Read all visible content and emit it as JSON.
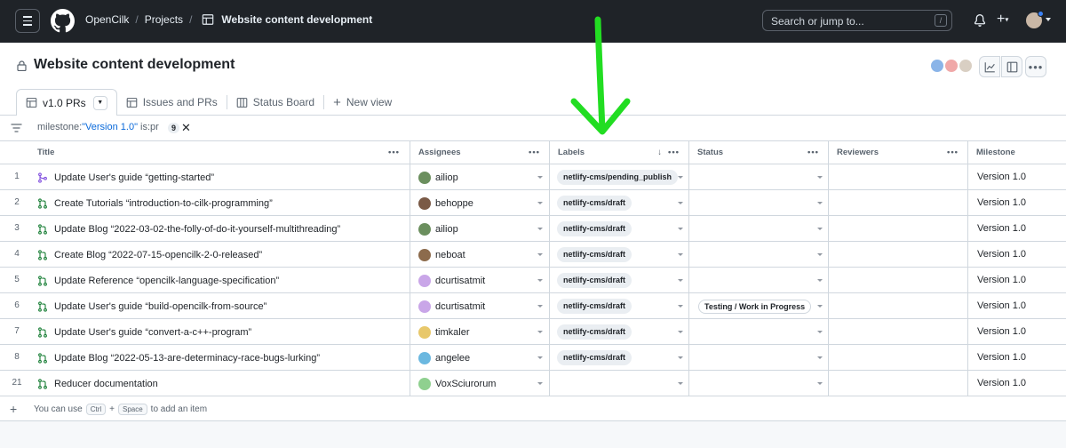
{
  "header": {
    "org": "OpenCilk",
    "projects": "Projects",
    "project_name": "Website content development",
    "search_placeholder": "Search or jump to...",
    "search_key": "/"
  },
  "project": {
    "title": "Website content development"
  },
  "tabs": [
    {
      "label": "v1.0 PRs",
      "active": true
    },
    {
      "label": "Issues and PRs",
      "active": false
    },
    {
      "label": "Status Board",
      "active": false
    },
    {
      "label": "New view",
      "active": false
    }
  ],
  "filter": {
    "prefix": "milestone:",
    "value": "\"Version 1.0\"",
    "suffix": " is:pr",
    "count": "9"
  },
  "columns": {
    "title": "Title",
    "assignees": "Assignees",
    "labels": "Labels",
    "status": "Status",
    "reviewers": "Reviewers",
    "milestone": "Milestone"
  },
  "rows": [
    {
      "num": "1",
      "title": "Update User's guide “getting-started”",
      "assignee": "ailiop",
      "label": "netlify-cms/pending_publish",
      "status": "",
      "milestone": "Version 1.0",
      "icon": "merged"
    },
    {
      "num": "2",
      "title": "Create Tutorials “introduction-to-cilk-programming”",
      "assignee": "behoppe",
      "label": "netlify-cms/draft",
      "status": "",
      "milestone": "Version 1.0",
      "icon": "open"
    },
    {
      "num": "3",
      "title": "Update Blog “2022-03-02-the-folly-of-do-it-yourself-multithreading”",
      "assignee": "ailiop",
      "label": "netlify-cms/draft",
      "status": "",
      "milestone": "Version 1.0",
      "icon": "open"
    },
    {
      "num": "4",
      "title": "Create Blog “2022-07-15-opencilk-2-0-released”",
      "assignee": "neboat",
      "label": "netlify-cms/draft",
      "status": "",
      "milestone": "Version 1.0",
      "icon": "open"
    },
    {
      "num": "5",
      "title": "Update Reference “opencilk-language-specification”",
      "assignee": "dcurtisatmit",
      "label": "netlify-cms/draft",
      "status": "",
      "milestone": "Version 1.0",
      "icon": "open"
    },
    {
      "num": "6",
      "title": "Update User's guide “build-opencilk-from-source”",
      "assignee": "dcurtisatmit",
      "label": "netlify-cms/draft",
      "status": "Testing / Work in Progress",
      "milestone": "Version 1.0",
      "icon": "open"
    },
    {
      "num": "7",
      "title": "Update User's guide “convert-a-c++-program”",
      "assignee": "timkaler",
      "label": "netlify-cms/draft",
      "status": "",
      "milestone": "Version 1.0",
      "icon": "open"
    },
    {
      "num": "8",
      "title": "Update Blog “2022-05-13-are-determinacy-race-bugs-lurking”",
      "assignee": "angelee",
      "label": "netlify-cms/draft",
      "status": "",
      "milestone": "Version 1.0",
      "icon": "open"
    },
    {
      "num": "21",
      "title": "Reducer documentation",
      "assignee": "VoxSciurorum",
      "label": "",
      "status": "",
      "milestone": "Version 1.0",
      "icon": "open"
    }
  ],
  "add_item": {
    "prefix": "You can use",
    "key1": "Ctrl",
    "plus": "+",
    "key2": "Space",
    "suffix": "to add an item"
  },
  "colors": {
    "topbar": "#1f2328",
    "open_pr": "#1a7f37",
    "merged_pr": "#8250df",
    "arrow": "#22dd22"
  }
}
